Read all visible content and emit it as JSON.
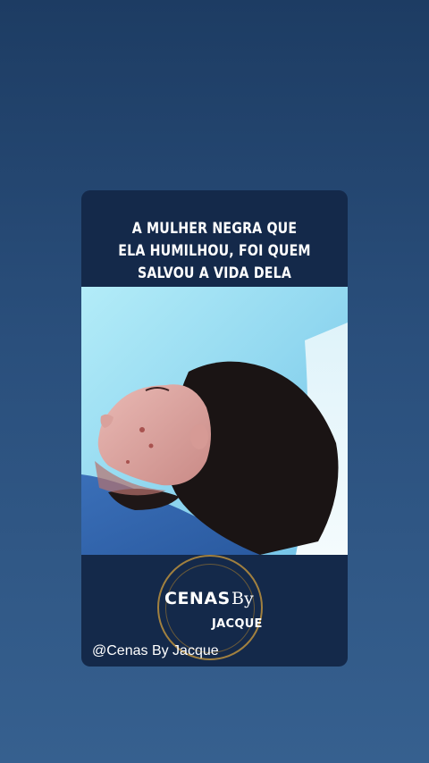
{
  "post": {
    "caption_lines": [
      "A MULHER NEGRA QUE",
      "ELA HUMILHOU, FOI QUEM",
      "SALVOU A VIDA DELA"
    ],
    "video": {
      "description_icon": "video-thumbnail"
    },
    "brand": {
      "logo_main": "CENAS",
      "logo_by": "By",
      "logo_sub": "JACQUE"
    },
    "handle": "@Cenas By Jacque"
  },
  "colors": {
    "background_top": "#1d3c63",
    "background_bottom": "#36608f",
    "card": "#14294a",
    "accent_gold": "#b08a3e"
  }
}
